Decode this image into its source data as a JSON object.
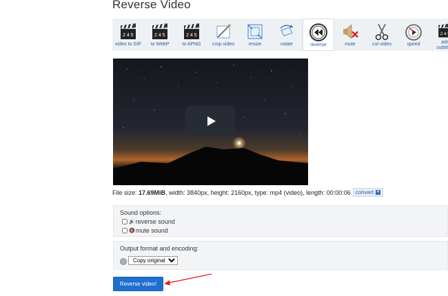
{
  "page": {
    "title": "Reverse Video"
  },
  "toolbar": {
    "items": [
      {
        "label": "video to GIF",
        "icon": "clapperboard-icon"
      },
      {
        "label": "to WebP",
        "icon": "clapperboard-icon"
      },
      {
        "label": "to APNG",
        "icon": "clapperboard-icon"
      },
      {
        "label": "crop video",
        "icon": "crop-icon"
      },
      {
        "label": "resize",
        "icon": "resize-icon"
      },
      {
        "label": "rotate",
        "icon": "rotate-icon"
      },
      {
        "label": "reverse",
        "icon": "rewind-icon",
        "active": true
      },
      {
        "label": "mute",
        "icon": "speaker-mute-icon"
      },
      {
        "label": "cut video",
        "icon": "scissors-icon"
      },
      {
        "label": "speed",
        "icon": "speedometer-icon"
      },
      {
        "label": "add subtitles",
        "icon": "clapperboard-icon"
      }
    ]
  },
  "video": {
    "play_icon": "play-icon"
  },
  "file_info": {
    "prefix": "File size: ",
    "size": "17.69MiB",
    "details": ", width: 3840px, height: 2160px, type: mp4 (video), length: 00:00:06",
    "convert_label": "convert"
  },
  "sound_options": {
    "heading": "Sound options:",
    "reverse_label": "reverse sound",
    "mute_label": "mute sound"
  },
  "output": {
    "heading": "Output format and encoding:",
    "selected": "Copy original"
  },
  "submit": {
    "label": "Reverse video!"
  },
  "colors": {
    "accent": "#1f6fd1",
    "link": "#2a5d9f",
    "annotation_arrow": "#e02020"
  }
}
